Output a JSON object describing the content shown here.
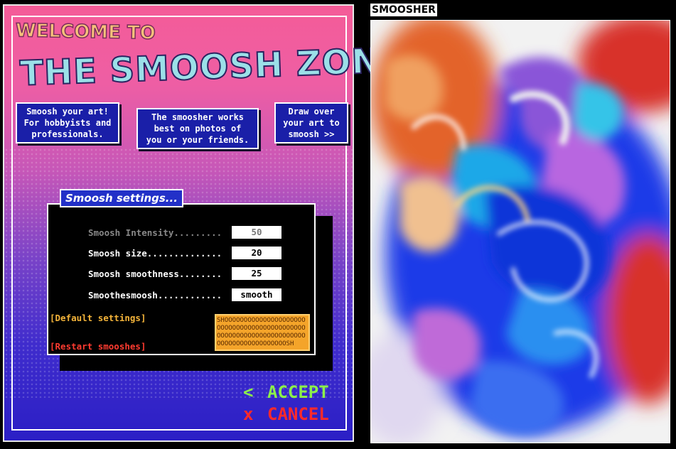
{
  "header": {
    "welcome": "WELCOME TO",
    "title": "THE SMOOSH ZONE!"
  },
  "info_boxes": [
    {
      "text": "Smoosh your art!\nFor hobbyists and\nprofessionals."
    },
    {
      "text": "The smoosher works\nbest on photos of\nyou or your friends."
    },
    {
      "text": "Draw over\nyour art to\nsmoosh >>"
    }
  ],
  "settings": {
    "title": "Smoosh settings...",
    "rows": [
      {
        "label": "Smoosh Intensity.........",
        "value": "50",
        "disabled": true
      },
      {
        "label": "Smoosh size..............",
        "value": "20",
        "disabled": false
      },
      {
        "label": "Smoosh smoothness........",
        "value": "25",
        "disabled": false
      },
      {
        "label": "Smoothesmoosh............",
        "value": "smooth",
        "disabled": false
      }
    ],
    "default_label": "[Default settings]",
    "restart_label": "[Restart smooshes]",
    "smoosh_button": "SHOOOOOOOOOOOOOOOOOOOOOOOOOOOOOOOOOOOOOOOOOOOOOOOOOOOOOOOOOOOOOOOOOOOOOOOOOOOOOOOOOOOOOSH"
  },
  "actions": {
    "accept_icon": "<",
    "accept": "ACCEPT",
    "cancel_icon": "x",
    "cancel": "CANCEL"
  },
  "canvas": {
    "title": "SMOOSHER"
  },
  "colors": {
    "accept": "#8cf04a",
    "cancel": "#ff2a2a",
    "default_link": "#f4b43a",
    "restart_link": "#ff3b30",
    "smoosh_button": "#f4a42a"
  }
}
